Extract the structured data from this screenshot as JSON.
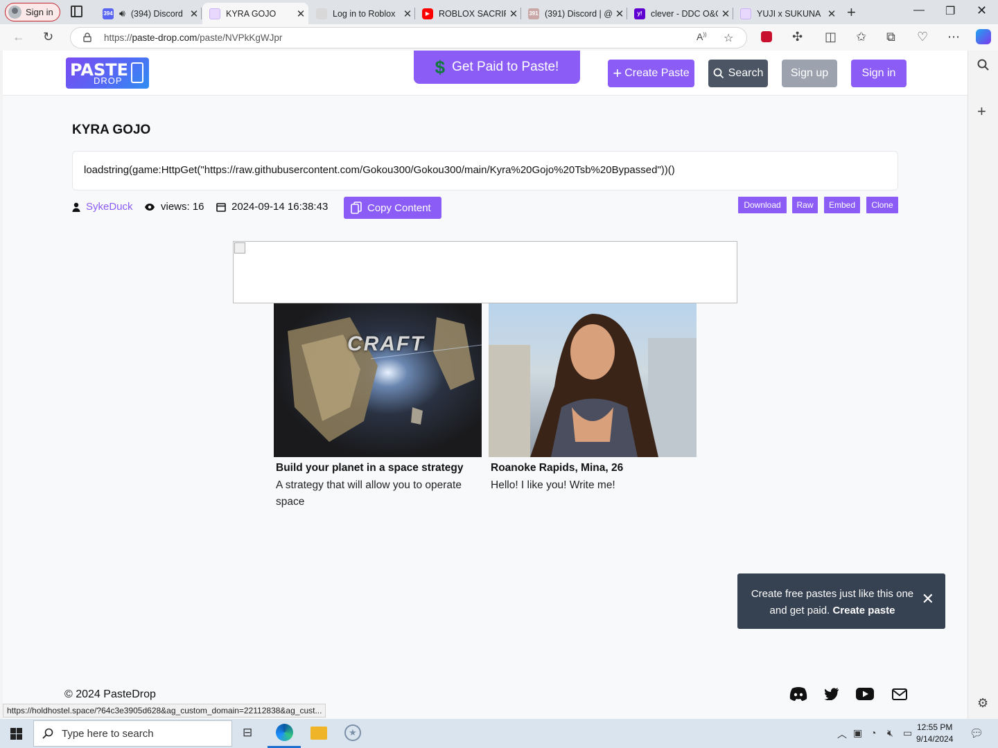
{
  "browser": {
    "profile_label": "Sign in",
    "tabs": [
      {
        "label": "(394) Discord",
        "active": false
      },
      {
        "label": "KYRA GOJO",
        "active": true
      },
      {
        "label": "Log in to Roblox",
        "active": false
      },
      {
        "label": "ROBLOX SACRIFIC",
        "active": false
      },
      {
        "label": "(391) Discord | @",
        "active": false
      },
      {
        "label": "clever - DDC O&C",
        "active": false
      },
      {
        "label": "YUJI x SUKUNA",
        "active": false
      }
    ],
    "discord_badge_1": "394",
    "discord_badge_2": "391",
    "url_prefix": "https://",
    "url_host": "paste-drop.com",
    "url_path": "/paste/NVPkKgWJpr"
  },
  "site": {
    "logo_top": "PASTE",
    "logo_bottom": "DROP",
    "get_paid_label": "Get Paid to Paste!",
    "create_paste_label": "Create Paste",
    "search_label": "Search",
    "signup_label": "Sign up",
    "signin_label": "Sign in"
  },
  "paste": {
    "title": "KYRA GOJO",
    "content": "loadstring(game:HttpGet(\"https://raw.githubusercontent.com/Gokou300/Gokou300/main/Kyra%20Gojo%20Tsb%20Bypassed\"))()",
    "author": "SykeDuck",
    "views_label": "views: 16",
    "date": "2024-09-14 16:38:43",
    "copy_label": "Copy Content",
    "actions": [
      "Download",
      "Raw",
      "Embed",
      "Clone"
    ]
  },
  "ads": [
    {
      "headline": "Build your planet in a space strategy",
      "description": "A strategy that will allow you to operate space",
      "image_text": "CRAFT"
    },
    {
      "headline": "Roanoke Rapids, Mina, 26",
      "description": "Hello! I like you! Write me!"
    }
  ],
  "toast": {
    "text": "Create free pastes just like this one and get paid.",
    "link": "Create paste"
  },
  "footer": {
    "copyright": "© 2024 PasteDrop"
  },
  "status_url": "https://holdhostel.space/?64c3e3905d628&ag_custom_domain=22112838&ag_cust...",
  "taskbar": {
    "search_placeholder": "Type here to search",
    "time": "12:55 PM",
    "date": "9/14/2024"
  },
  "colors": {
    "accent": "#8b5cf6",
    "dark_button": "#4b5563",
    "muted_button": "#9ca3af",
    "toast_bg": "#364152",
    "profile_border": "#c4262e"
  }
}
